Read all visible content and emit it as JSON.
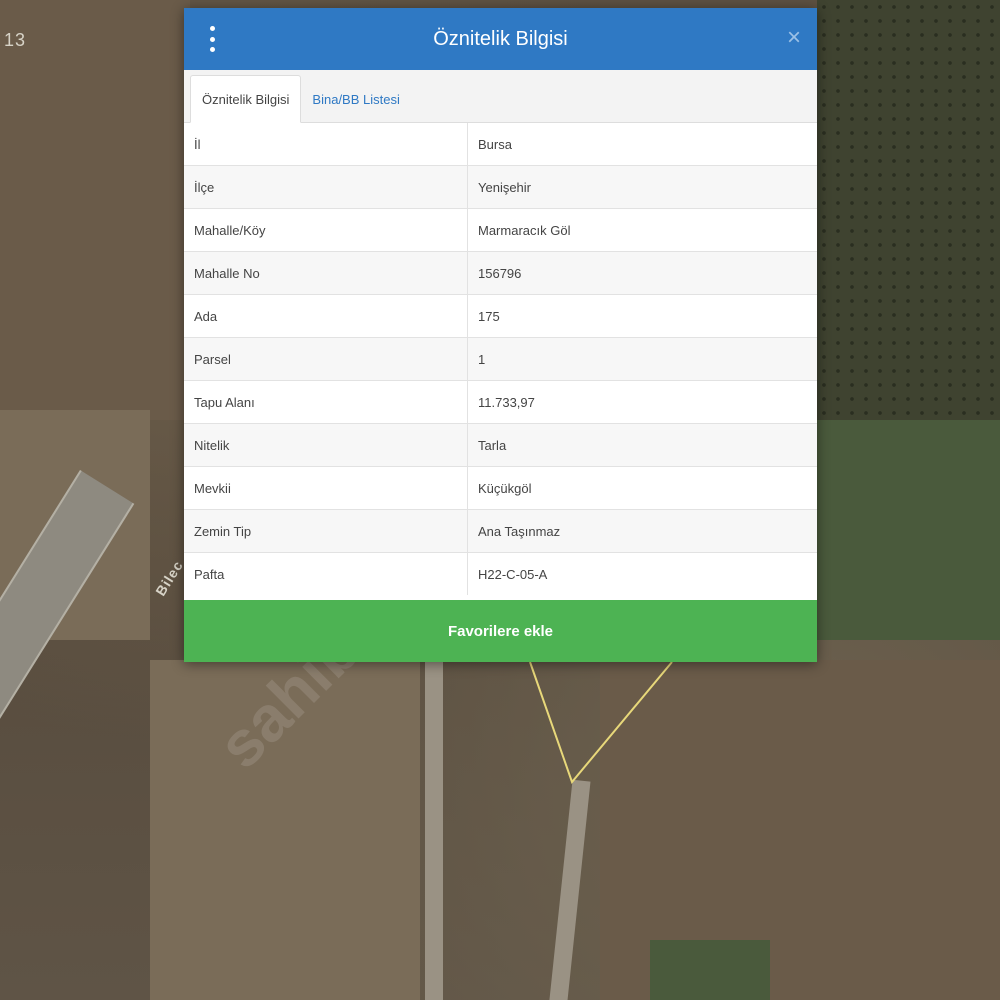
{
  "map": {
    "corner_label": "13",
    "road_label": "Bilec",
    "watermark": "sahibinden"
  },
  "dialog": {
    "title": "Öznitelik Bilgisi",
    "menu_icon": "vertical-ellipsis-icon",
    "close_icon": "close-icon",
    "close_glyph": "×",
    "tabs": [
      {
        "label": "Öznitelik Bilgisi",
        "active": true
      },
      {
        "label": "Bina/BB Listesi",
        "active": false
      }
    ],
    "rows": [
      {
        "key": "İl",
        "value": "Bursa"
      },
      {
        "key": "İlçe",
        "value": "Yenişehir"
      },
      {
        "key": "Mahalle/Köy",
        "value": "Marmaracık Göl"
      },
      {
        "key": "Mahalle No",
        "value": "156796"
      },
      {
        "key": "Ada",
        "value": "175"
      },
      {
        "key": "Parsel",
        "value": "1"
      },
      {
        "key": "Tapu Alanı",
        "value": "11.733,97"
      },
      {
        "key": "Nitelik",
        "value": "Tarla"
      },
      {
        "key": "Mevkii",
        "value": "Küçükgöl"
      },
      {
        "key": "Zemin Tip",
        "value": "Ana Taşınmaz"
      },
      {
        "key": "Pafta",
        "value": "H22-C-05-A"
      }
    ],
    "favorites_button": "Favorilere ekle"
  },
  "colors": {
    "header": "#2f79c4",
    "favorites_button": "#4db353",
    "parcel_outline": "#e8d87a"
  }
}
